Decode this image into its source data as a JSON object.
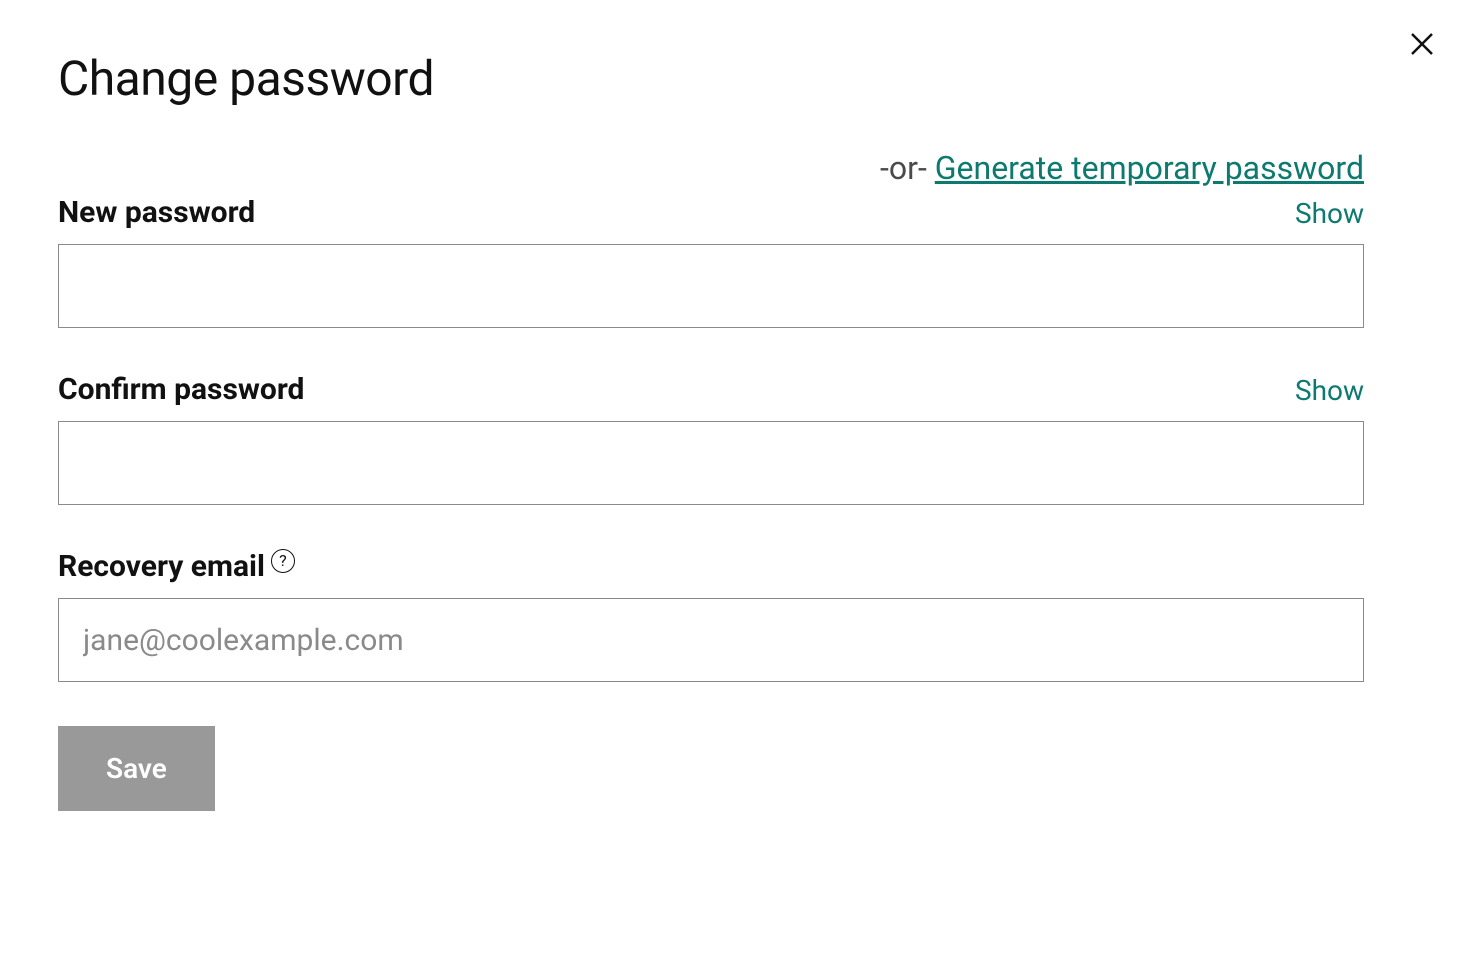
{
  "title": "Change password",
  "or_text": "-or- ",
  "generate_link": "Generate temporary password",
  "fields": {
    "new_password": {
      "label": "New password",
      "show": "Show",
      "value": ""
    },
    "confirm_password": {
      "label": "Confirm password",
      "show": "Show",
      "value": ""
    },
    "recovery_email": {
      "label": "Recovery email",
      "placeholder": "jane@coolexample.com",
      "value": ""
    }
  },
  "help_icon_text": "?",
  "save_button": "Save"
}
